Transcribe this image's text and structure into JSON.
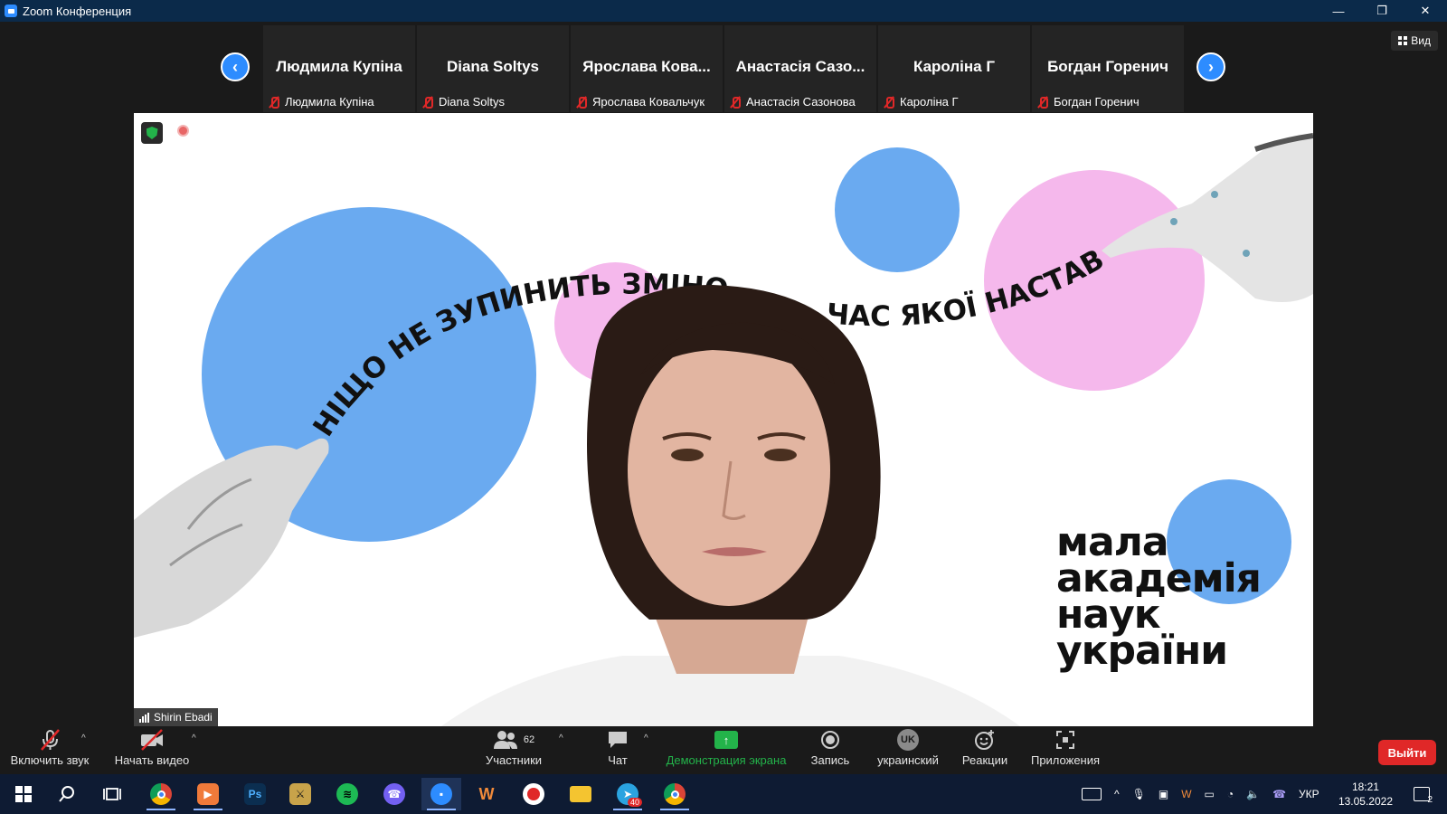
{
  "window": {
    "title": "Zoom Конференция",
    "minimize": "—",
    "restore": "❐",
    "close": "✕"
  },
  "view_button": {
    "label": "Вид"
  },
  "gallery": {
    "prev": "‹",
    "next": "›",
    "tiles": [
      {
        "display_name": "Людмила Купіна",
        "label": "Людмила Купіна"
      },
      {
        "display_name": "Diana Soltys",
        "label": "Diana Soltys"
      },
      {
        "display_name": "Ярослава Кова...",
        "label": "Ярослава Ковальчук"
      },
      {
        "display_name": "Анастасія Сазо...",
        "label": "Анастасія Сазонова"
      },
      {
        "display_name": "Кароліна Г",
        "label": "Кароліна Г"
      },
      {
        "display_name": "Богдан Горенич",
        "label": "Богдан Горенич"
      }
    ]
  },
  "main_video": {
    "speaker_label": "Shirin Ebadi",
    "arc_text": "НІЩО НЕ ЗУПИНИТЬ ЗМІНО",
    "arc_text_right": "ЧАС ЯКОЇ НАСТАВ!",
    "logo_lines": [
      "мала",
      "академія",
      "наук",
      "україни"
    ],
    "colors": {
      "blue": "#6aaaf0",
      "pink": "#f5b8ec"
    }
  },
  "toolbar": {
    "unmute": "Включить звук",
    "start_video": "Начать видео",
    "participants": "Участники",
    "participants_count": "62",
    "chat": "Чат",
    "share": "Демонстрация экрана",
    "record": "Запись",
    "language": "украинский",
    "language_code": "UK",
    "reactions": "Реакции",
    "apps": "Приложения",
    "leave": "Выйти",
    "share_color": "#23b34a",
    "leave_color": "#e02828"
  },
  "taskbar": {
    "time": "18:21",
    "date": "13.05.2022",
    "lang": "УКР",
    "notification_count": "2",
    "telegram_badge": "40"
  }
}
